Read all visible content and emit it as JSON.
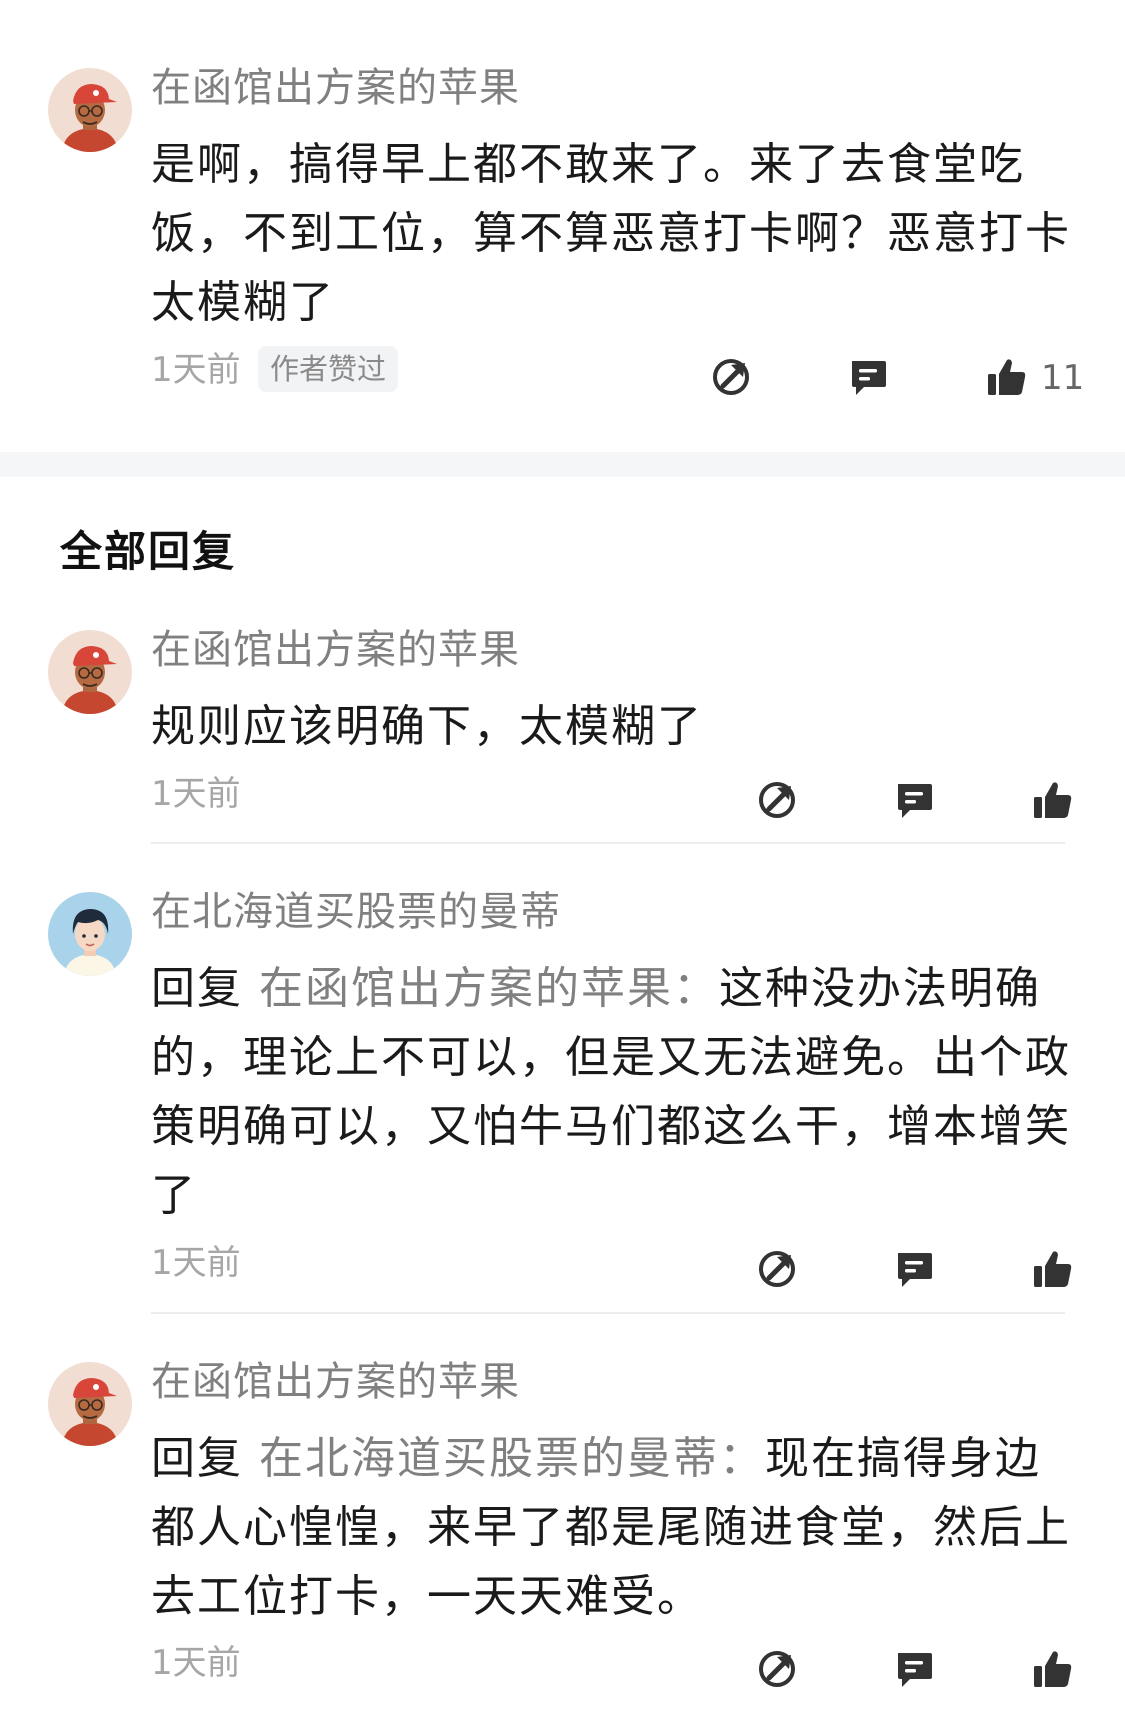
{
  "main_comment": {
    "author": "在函馆出方案的苹果",
    "text": "是啊，搞得早上都不敢来了。来了去食堂吃饭，不到工位，算不算恶意打卡啊？恶意打卡太模糊了",
    "time": "1天前",
    "badge": "作者赞过",
    "like_count": "11",
    "avatar": "avatar-red-cap"
  },
  "section_title": "全部回复",
  "replies": [
    {
      "author": "在函馆出方案的苹果",
      "text": "规则应该明确下，太模糊了",
      "time": "1天前",
      "avatar": "avatar-red-cap"
    },
    {
      "author": "在北海道买股票的曼蒂",
      "reply_prefix": "回复",
      "mention": "在函馆出方案的苹果：",
      "text": "这种没办法明确的，理论上不可以，但是又无法避免。出个政策明确可以，又怕牛马们都这么干，增本增笑了",
      "time": "1天前",
      "avatar": "avatar-dark-hair"
    },
    {
      "author": "在函馆出方案的苹果",
      "reply_prefix": "回复",
      "mention": "在北海道买股票的曼蒂：",
      "text": "现在搞得身边都人心惶惶，来早了都是尾随进食堂，然后上去工位打卡，一天天难受。",
      "time": "1天前",
      "avatar": "avatar-red-cap"
    }
  ],
  "icons": {
    "share": "share-icon",
    "comment": "comment-icon",
    "like": "thumbs-up-icon"
  },
  "colors": {
    "text": "#1a1a1a",
    "secondary": "#808080",
    "time": "#a6a6a6",
    "icon": "#333333",
    "avatar_red_bg": "#f2ddd2",
    "avatar_blue_bg": "#a9d3ea"
  }
}
